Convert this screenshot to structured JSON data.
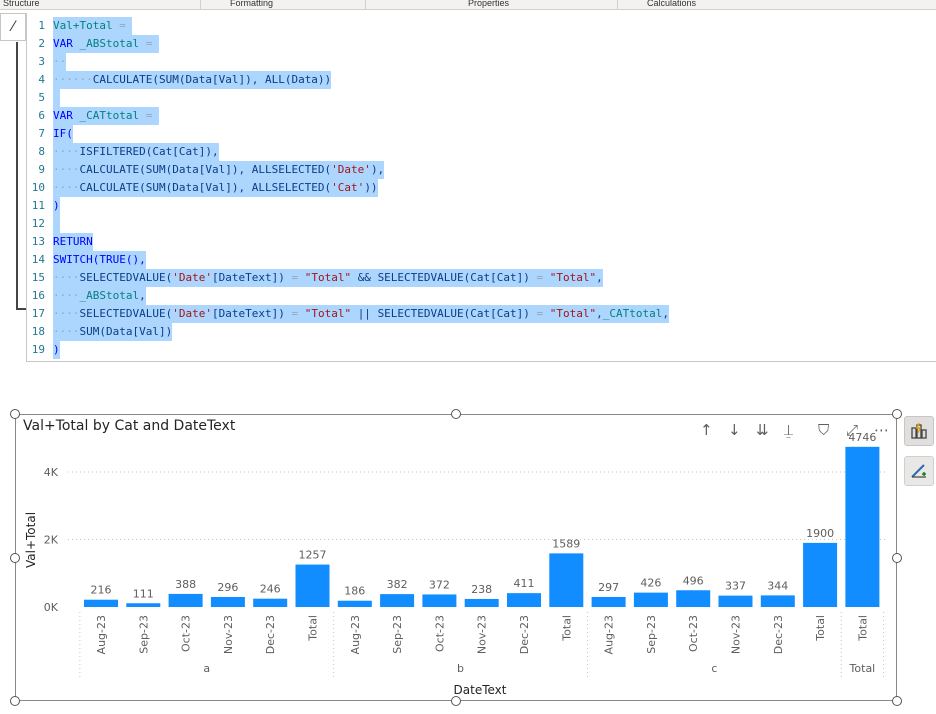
{
  "ribbon": {
    "tabs": [
      "Structure",
      "Formatting",
      "Properties",
      "Calculations"
    ]
  },
  "editor": {
    "cancel_icon": "slash-icon",
    "lines": [
      {
        "n": "1",
        "parts": [
          [
            "var",
            "Val+Total"
          ],
          [
            "dot",
            " = "
          ]
        ]
      },
      {
        "n": "2",
        "parts": [
          [
            "kw",
            "VAR"
          ],
          [
            "dot",
            " "
          ],
          [
            "var",
            "_ABStotal"
          ],
          [
            "dot",
            " = "
          ]
        ]
      },
      {
        "n": "3",
        "parts": [
          [
            "dot",
            "··"
          ]
        ]
      },
      {
        "n": "4",
        "parts": [
          [
            "dot",
            "······"
          ],
          [
            "fn",
            "CALCULATE(SUM(Data[Val]),"
          ],
          [
            "dot",
            " "
          ],
          [
            "fn",
            "ALL(Data))"
          ]
        ]
      },
      {
        "n": "5",
        "parts": [
          [
            "dot",
            " "
          ]
        ]
      },
      {
        "n": "6",
        "parts": [
          [
            "kw",
            "VAR"
          ],
          [
            "dot",
            " "
          ],
          [
            "var",
            "_CATtotal"
          ],
          [
            "dot",
            " = "
          ]
        ]
      },
      {
        "n": "7",
        "parts": [
          [
            "kw",
            "IF("
          ]
        ]
      },
      {
        "n": "8",
        "parts": [
          [
            "dot",
            "····"
          ],
          [
            "fn",
            "ISFILTERED(Cat[Cat]),"
          ]
        ]
      },
      {
        "n": "9",
        "parts": [
          [
            "dot",
            "····"
          ],
          [
            "fn",
            "CALCULATE(SUM(Data[Val]),"
          ],
          [
            "dot",
            " "
          ],
          [
            "fn",
            "ALLSELECTED("
          ],
          [
            "str",
            "'Date'"
          ],
          [
            "fn",
            "),"
          ]
        ]
      },
      {
        "n": "10",
        "parts": [
          [
            "dot",
            "····"
          ],
          [
            "fn",
            "CALCULATE(SUM(Data[Val]),"
          ],
          [
            "dot",
            " "
          ],
          [
            "fn",
            "ALLSELECTED("
          ],
          [
            "str",
            "'Cat'"
          ],
          [
            "fn",
            "))"
          ]
        ]
      },
      {
        "n": "11",
        "parts": [
          [
            "kw",
            ")"
          ]
        ]
      },
      {
        "n": "12",
        "parts": [
          [
            "dot",
            " "
          ]
        ]
      },
      {
        "n": "13",
        "parts": [
          [
            "kw",
            "RETURN"
          ]
        ]
      },
      {
        "n": "14",
        "parts": [
          [
            "kw",
            "SWITCH(TRUE(),"
          ]
        ]
      },
      {
        "n": "15",
        "parts": [
          [
            "dot",
            "····"
          ],
          [
            "fn",
            "SELECTEDVALUE("
          ],
          [
            "str",
            "'Date'"
          ],
          [
            "fn",
            "[DateText])"
          ],
          [
            "dot",
            " = "
          ],
          [
            "str",
            "\"Total\""
          ],
          [
            "dot",
            " "
          ],
          [
            "fn",
            "&&"
          ],
          [
            "dot",
            " "
          ],
          [
            "fn",
            "SELECTEDVALUE(Cat[Cat])"
          ],
          [
            "dot",
            " = "
          ],
          [
            "str",
            "\"Total\""
          ],
          [
            "fn",
            ","
          ]
        ]
      },
      {
        "n": "16",
        "parts": [
          [
            "dot",
            "····"
          ],
          [
            "var",
            "_ABStotal"
          ],
          [
            "fn",
            ","
          ]
        ]
      },
      {
        "n": "17",
        "parts": [
          [
            "dot",
            "····"
          ],
          [
            "fn",
            "SELECTEDVALUE("
          ],
          [
            "str",
            "'Date'"
          ],
          [
            "fn",
            "[DateText])"
          ],
          [
            "dot",
            " = "
          ],
          [
            "str",
            "\"Total\""
          ],
          [
            "dot",
            " "
          ],
          [
            "fn",
            "||"
          ],
          [
            "dot",
            " "
          ],
          [
            "fn",
            "SELECTEDVALUE(Cat[Cat])"
          ],
          [
            "dot",
            " = "
          ],
          [
            "str",
            "\"Total\""
          ],
          [
            "fn",
            ","
          ],
          [
            "var",
            "_CATtotal"
          ],
          [
            "fn",
            ","
          ]
        ]
      },
      {
        "n": "18",
        "parts": [
          [
            "dot",
            "····"
          ],
          [
            "fn",
            "SUM(Data[Val])"
          ]
        ]
      },
      {
        "n": "19",
        "parts": [
          [
            "kw",
            ")"
          ]
        ]
      }
    ]
  },
  "visual": {
    "title": "Val+Total by Cat and DateText",
    "header_icons": [
      "arrow-up-icon",
      "arrow-down-icon",
      "double-arrow-down-icon",
      "expand-hierarchy-icon",
      "filter-icon",
      "focus-mode-icon",
      "more-options-icon"
    ],
    "header_glyphs": [
      "↑",
      "↓",
      "⇊",
      "⍊",
      "⛉",
      "⤢",
      "⋯"
    ],
    "side_buttons": [
      {
        "name": "format-visual-button",
        "glyph": "⚡"
      },
      {
        "name": "analytics-button",
        "glyph": "⚙"
      }
    ]
  },
  "chart_data": {
    "type": "bar",
    "title": "Val+Total by Cat and DateText",
    "xlabel": "DateText",
    "ylabel": "Val+Total",
    "ylim": [
      0,
      5000
    ],
    "y_ticks": [
      {
        "v": 0,
        "label": "0K"
      },
      {
        "v": 2000,
        "label": "2K"
      },
      {
        "v": 4000,
        "label": "4K"
      }
    ],
    "grid": true,
    "color": "#118DFF",
    "groups": [
      {
        "name": "a",
        "bars": [
          {
            "label": "Aug-23",
            "value": 216
          },
          {
            "label": "Sep-23",
            "value": 111
          },
          {
            "label": "Oct-23",
            "value": 388
          },
          {
            "label": "Nov-23",
            "value": 296
          },
          {
            "label": "Dec-23",
            "value": 246
          },
          {
            "label": "Total",
            "value": 1257
          }
        ]
      },
      {
        "name": "b",
        "bars": [
          {
            "label": "Aug-23",
            "value": 186
          },
          {
            "label": "Sep-23",
            "value": 382
          },
          {
            "label": "Oct-23",
            "value": 372
          },
          {
            "label": "Nov-23",
            "value": 238
          },
          {
            "label": "Dec-23",
            "value": 411
          },
          {
            "label": "Total",
            "value": 1589
          }
        ]
      },
      {
        "name": "c",
        "bars": [
          {
            "label": "Aug-23",
            "value": 297
          },
          {
            "label": "Sep-23",
            "value": 426
          },
          {
            "label": "Oct-23",
            "value": 496
          },
          {
            "label": "Nov-23",
            "value": 337
          },
          {
            "label": "Dec-23",
            "value": 344
          },
          {
            "label": "Total",
            "value": 1900
          }
        ]
      },
      {
        "name": "Total",
        "bars": [
          {
            "label": "Total",
            "value": 4746
          }
        ]
      }
    ]
  }
}
